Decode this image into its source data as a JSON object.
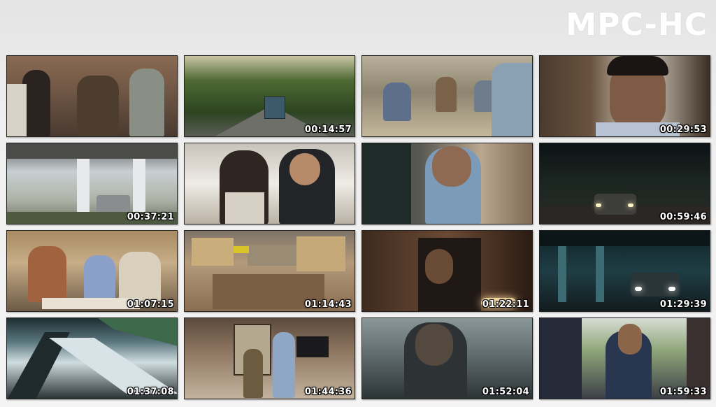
{
  "brand": {
    "text": "MPC-HC"
  },
  "thumbnails": [
    {
      "timestamp": ""
    },
    {
      "timestamp": "00:14:57"
    },
    {
      "timestamp": ""
    },
    {
      "timestamp": "00:29:53"
    },
    {
      "timestamp": "00:37:21"
    },
    {
      "timestamp": ""
    },
    {
      "timestamp": ""
    },
    {
      "timestamp": "00:59:46"
    },
    {
      "timestamp": "01:07:15"
    },
    {
      "timestamp": "01:14:43"
    },
    {
      "timestamp": "01:22:11"
    },
    {
      "timestamp": "01:29:39"
    },
    {
      "timestamp": "01:37:08"
    },
    {
      "timestamp": "01:44:36"
    },
    {
      "timestamp": "01:52:04"
    },
    {
      "timestamp": "01:59:33"
    }
  ]
}
